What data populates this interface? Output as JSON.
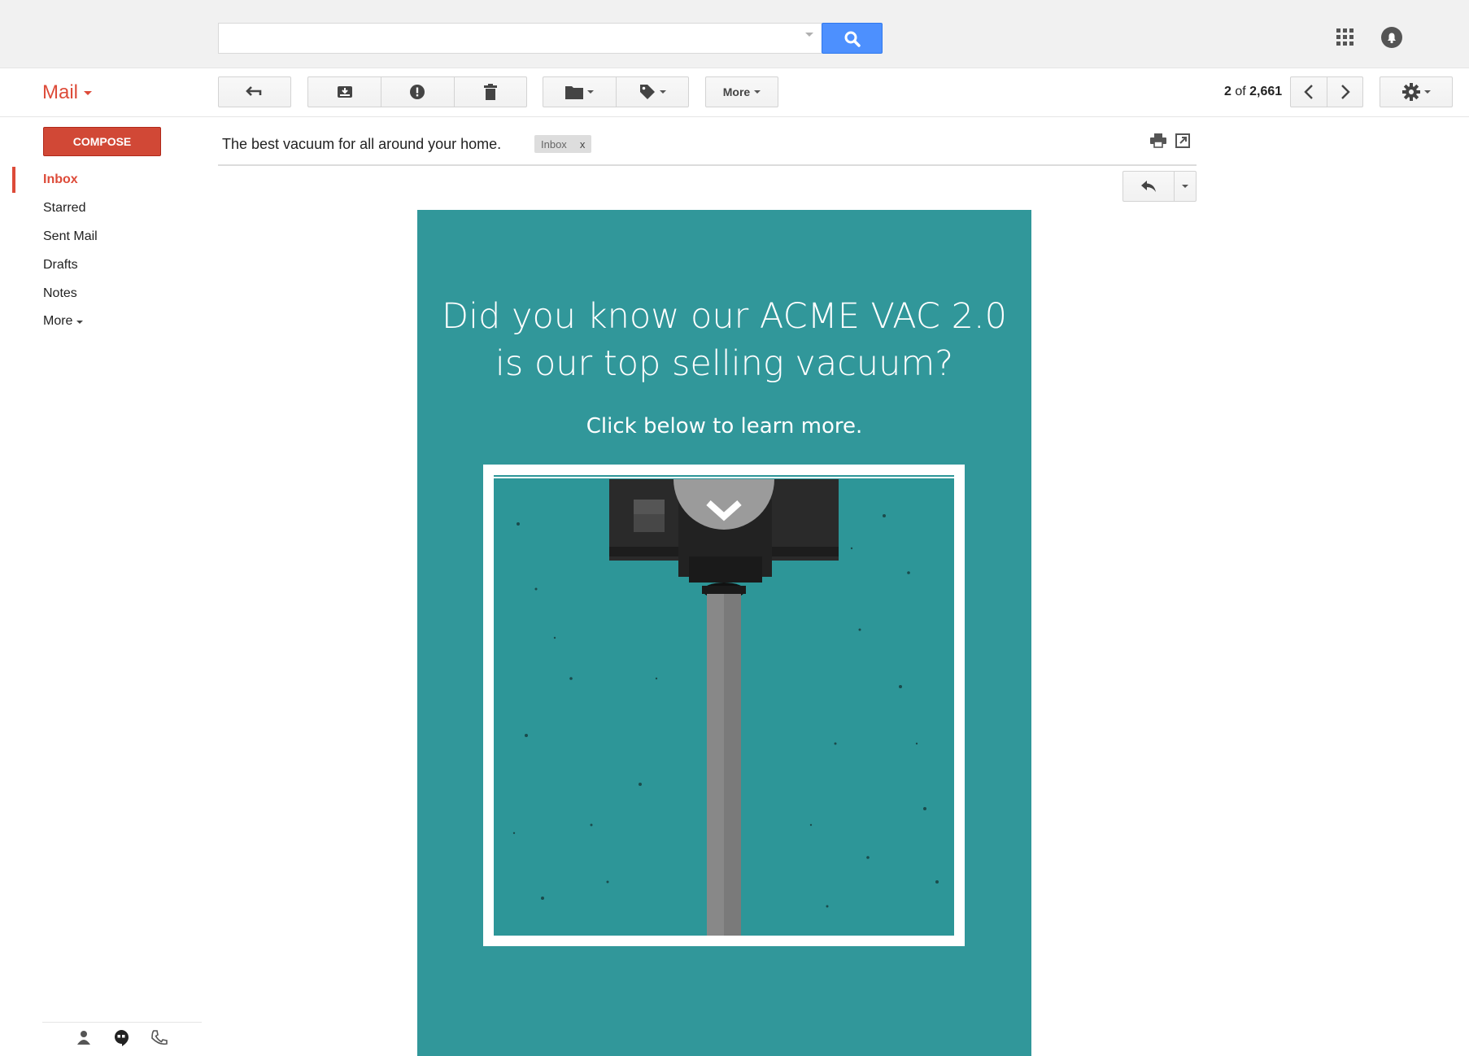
{
  "app": {
    "name": "Mail"
  },
  "search": {
    "value": "",
    "placeholder": ""
  },
  "header_icons": [
    "apps-grid-icon",
    "notifications-icon"
  ],
  "toolbar": {
    "buttons": [
      "back-arrow-icon",
      "archive-icon",
      "report-spam-icon",
      "delete-icon",
      "move-to-folder-icon",
      "labels-icon"
    ],
    "more_label": "More",
    "pager": {
      "current": "2",
      "of": "of",
      "total": "2,661"
    }
  },
  "sidebar": {
    "compose_label": "COMPOSE",
    "items": [
      {
        "label": "Inbox",
        "active": true
      },
      {
        "label": "Starred"
      },
      {
        "label": "Sent Mail"
      },
      {
        "label": "Drafts"
      },
      {
        "label": "Notes"
      },
      {
        "label": "More"
      }
    ],
    "bottom_icons": [
      "contacts-icon",
      "hangouts-icon",
      "phone-icon"
    ]
  },
  "message": {
    "subject": "The best vacuum for all around your home.",
    "label": "Inbox",
    "label_remove": "x",
    "email": {
      "headline_line1": "Did you know our ACME VAC 2.0",
      "headline_line2": "is our top selling vacuum?",
      "subhead": "Click below to learn more."
    }
  },
  "colors": {
    "accent_red": "#dd4b39",
    "compose_red": "#d14836",
    "search_blue": "#4d90fe",
    "email_teal": "#31979a"
  }
}
